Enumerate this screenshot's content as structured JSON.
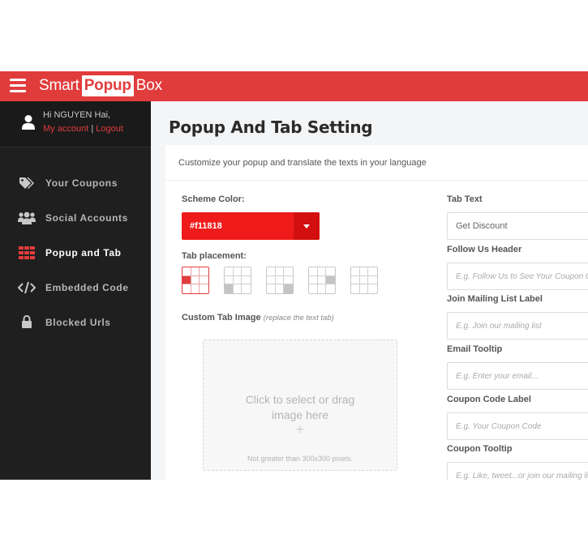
{
  "brand": {
    "part1": "Smart",
    "part2": "Popup",
    "part3": "Box"
  },
  "user": {
    "greeting": "Hi NGUYEN Hai,",
    "my_account": "My account",
    "separator": "|",
    "logout": "Logout"
  },
  "sidebar": {
    "items": [
      {
        "label": "Your Coupons",
        "icon": "tags-icon"
      },
      {
        "label": "Social Accounts",
        "icon": "users-icon"
      },
      {
        "label": "Popup and Tab",
        "icon": "grid-icon",
        "active": true
      },
      {
        "label": "Embedded Code",
        "icon": "code-icon"
      },
      {
        "label": "Blocked Urls",
        "icon": "lock-icon"
      }
    ]
  },
  "page": {
    "title": "Popup And Tab Setting",
    "subtitle": "Customize your popup and translate the texts in your language"
  },
  "left": {
    "scheme_label": "Scheme Color:",
    "scheme_value": "#f11818",
    "placement_label": "Tab placement:",
    "custom_image_label": "Custom Tab Image",
    "custom_image_hint": "(replace the text tab)",
    "dropzone_line1": "Click to select or drag",
    "dropzone_line2": "image here",
    "dropzone_plus": "+",
    "dropzone_note": "Not greater than 300x300 pixels."
  },
  "right": {
    "tab_text_label": "Tab Text",
    "tab_text_value": "Get Discount",
    "follow_header_label": "Follow Us Header",
    "follow_header_placeholder": "E.g. Follow Us to See Your Coupon Co",
    "mailing_label": "Join Mailing List Label",
    "mailing_placeholder": "E.g. Join our mailing list",
    "email_tooltip_label": "Email Tooltip",
    "email_tooltip_placeholder": "E.g. Enter your email...",
    "coupon_code_label": "Coupon Code Label",
    "coupon_code_placeholder": "E.g. Your Coupon Code",
    "coupon_tooltip_label": "Coupon Tooltip",
    "coupon_tooltip_placeholder": "E.g. Like, tweet...or join our mailing lis"
  },
  "colors": {
    "accent": "#e13c3c",
    "scheme": "#f11818",
    "sidebar_bg": "#1f1f1f"
  }
}
